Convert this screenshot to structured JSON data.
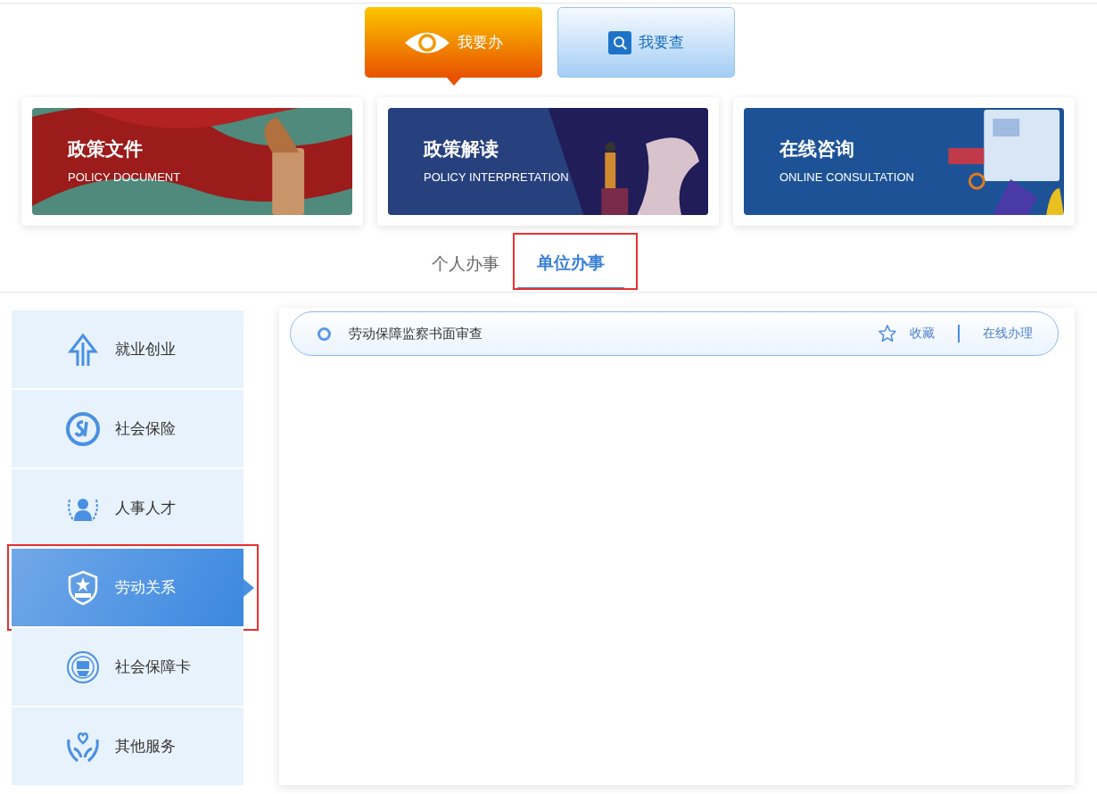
{
  "mode_buttons": [
    {
      "label": "我要办",
      "selected": true
    },
    {
      "label": "我要查",
      "selected": false
    }
  ],
  "cards": [
    {
      "title": "政策文件",
      "subtitle": "POLICY DOCUMENT",
      "kind": "flag"
    },
    {
      "title": "政策解读",
      "subtitle": "POLICY INTERPRETATION",
      "kind": "reading"
    },
    {
      "title": "在线咨询",
      "subtitle": "ONLINE CONSULTATION",
      "kind": "consult"
    }
  ],
  "tabs": [
    {
      "label": "个人办事",
      "selected": false
    },
    {
      "label": "单位办事",
      "selected": true
    }
  ],
  "sidebar": {
    "items": [
      {
        "label": "就业创业",
        "kind": "house",
        "selected": false
      },
      {
        "label": "社会保险",
        "kind": "si",
        "selected": false
      },
      {
        "label": "人事人才",
        "kind": "talent",
        "selected": false
      },
      {
        "label": "劳动关系",
        "kind": "shield",
        "selected": true
      },
      {
        "label": "社会保障卡",
        "kind": "card",
        "selected": false
      },
      {
        "label": "其他服务",
        "kind": "hands",
        "selected": false
      }
    ]
  },
  "services": [
    {
      "name": "劳动保障监察书面审查",
      "favorite_label": "收藏",
      "action_label": "在线办理"
    }
  ]
}
